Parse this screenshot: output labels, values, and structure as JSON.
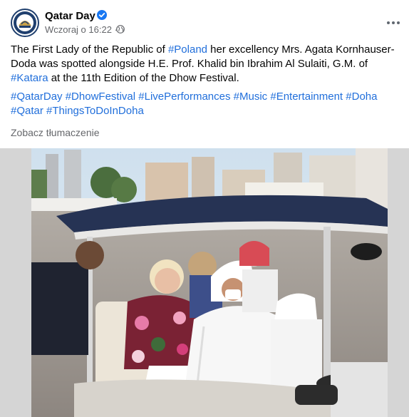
{
  "page": {
    "name": "Qatar Day",
    "timestamp": "Wczoraj o 16:22",
    "separator": "·"
  },
  "post": {
    "line1_pre": "The First Lady of the Republic of ",
    "line1_tag1": "#Poland",
    "line1_mid": " her excellency Mrs. Agata Kornhauser-Doda was spotted alongside H.E. Prof. Khalid bin Ibrahim Al Sulaiti, G.M. of ",
    "line1_tag2": "#Katara",
    "line1_post": " at the 11th Edition of the Dhow Festival.",
    "hashtags": [
      "#QatarDay",
      "#DhowFestival",
      "#LivePerformances",
      "#Music",
      "#Entertainment",
      "#Doha",
      "#Qatar",
      "#ThingsToDoInDoha"
    ],
    "translate_label": "Zobacz tłumaczenie"
  },
  "colors": {
    "link": "#216fdb",
    "verified": "#1877f2",
    "muted": "#65676b"
  },
  "icons": {
    "verified": "verified-badge-icon",
    "audience": "globe-icon",
    "more": "more-options-icon"
  }
}
